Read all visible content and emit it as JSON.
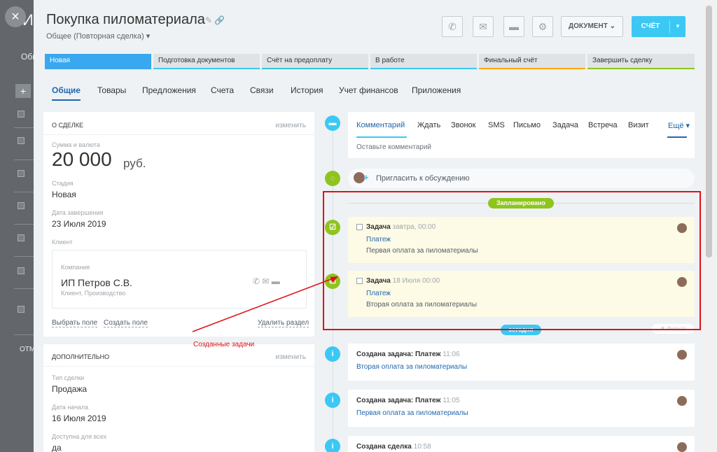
{
  "background": {
    "title": "ИП",
    "subtitle": "Общ",
    "footer_label": "ОТМ",
    "plus": "+"
  },
  "close_glyph": "×",
  "header": {
    "title": "Покупка пиломатериала",
    "title_icons": "✎ 🔗",
    "deal_type": "Общее (Повторная сделка) ▾",
    "icon_buttons": [
      "phone-icon",
      "mail-icon",
      "chat-icon",
      "gear-icon"
    ],
    "icon_glyphs": [
      "✆",
      "✉",
      "▬",
      "⚙"
    ],
    "document_button": "ДОКУМЕНТ",
    "document_arrow": "⌄",
    "bill_button": "СЧЁТ",
    "bill_arrow": "▼"
  },
  "stages": [
    {
      "label": "Новая",
      "color": "#39a8ef",
      "active": true
    },
    {
      "label": "Подготовка документов",
      "color": "#3bc8f5",
      "active": false
    },
    {
      "label": "Счёт на предоплату",
      "color": "#34c3d9",
      "active": false
    },
    {
      "label": "В работе",
      "color": "#3bc8f5",
      "active": false
    },
    {
      "label": "Финальный счёт",
      "color": "#ffa900",
      "active": false
    },
    {
      "label": "Завершить сделку",
      "color": "#8fc41d",
      "active": false
    }
  ],
  "tabs": [
    "Общие",
    "Товары",
    "Предложения",
    "Счета",
    "Связи",
    "История",
    "Учет финансов",
    "Приложения"
  ],
  "about": {
    "heading": "О СДЕЛКЕ",
    "edit": "изменить",
    "amount_label": "Сумма и валюта",
    "amount": "20 000",
    "currency": "руб.",
    "stage_label": "Стадия",
    "stage_value": "Новая",
    "end_date_label": "Дата завершения",
    "end_date_value": "23 Июля 2019",
    "client_label": "Клиент",
    "company_label": "Компания",
    "company_name": "ИП Петров С.В.",
    "company_meta": "Клиент, Производство",
    "client_icons": "✆  ✉  ▬",
    "select_field": "Выбрать поле",
    "create_field": "Создать поле",
    "delete_section": "Удалить раздел"
  },
  "additional": {
    "heading": "ДОПОЛНИТЕЛЬНО",
    "edit": "изменить",
    "type_label": "Тип сделки",
    "type_value": "Продажа",
    "start_label": "Дата начала",
    "start_value": "16 Июля 2019",
    "avail_label": "Доступна для всех",
    "avail_value": "да"
  },
  "editor": {
    "tabs": [
      "Комментарий",
      "Ждать",
      "Звонок",
      "SMS",
      "Письмо",
      "Задача",
      "Встреча",
      "Визит"
    ],
    "more": "Ещё ▾",
    "placeholder": "Оставьте комментарий"
  },
  "timeline_glyphs": {
    "comment": "▬",
    "invite": "◌",
    "task": "☑",
    "info": "i"
  },
  "invite_plus": "+",
  "invite_text": "Пригласить к обсуждению",
  "planned_badge": "Запланировано",
  "today_badge": "сегодня",
  "filter_text": "▼ Фильтр",
  "tasks": [
    {
      "title": "Задача",
      "time": "завтра, 00:00",
      "type": "Платеж",
      "desc": "Первая оплата за пиломатериалы"
    },
    {
      "title": "Задача",
      "time": "18 Июля 00:00",
      "type": "Платеж",
      "desc": "Вторая оплата за пиломатериалы"
    }
  ],
  "history": [
    {
      "title": "Создана задача: Платеж",
      "time": "11:06",
      "link": "Вторая оплата за пиломатериалы"
    },
    {
      "title": "Создана задача: Платеж",
      "time": "11:05",
      "link": "Первая оплата за пиломатериалы"
    },
    {
      "title": "Создана сделка",
      "time": "10:58",
      "link": ""
    }
  ],
  "annotation": {
    "text": "Созданные задачи",
    "color": "#e0101a"
  }
}
